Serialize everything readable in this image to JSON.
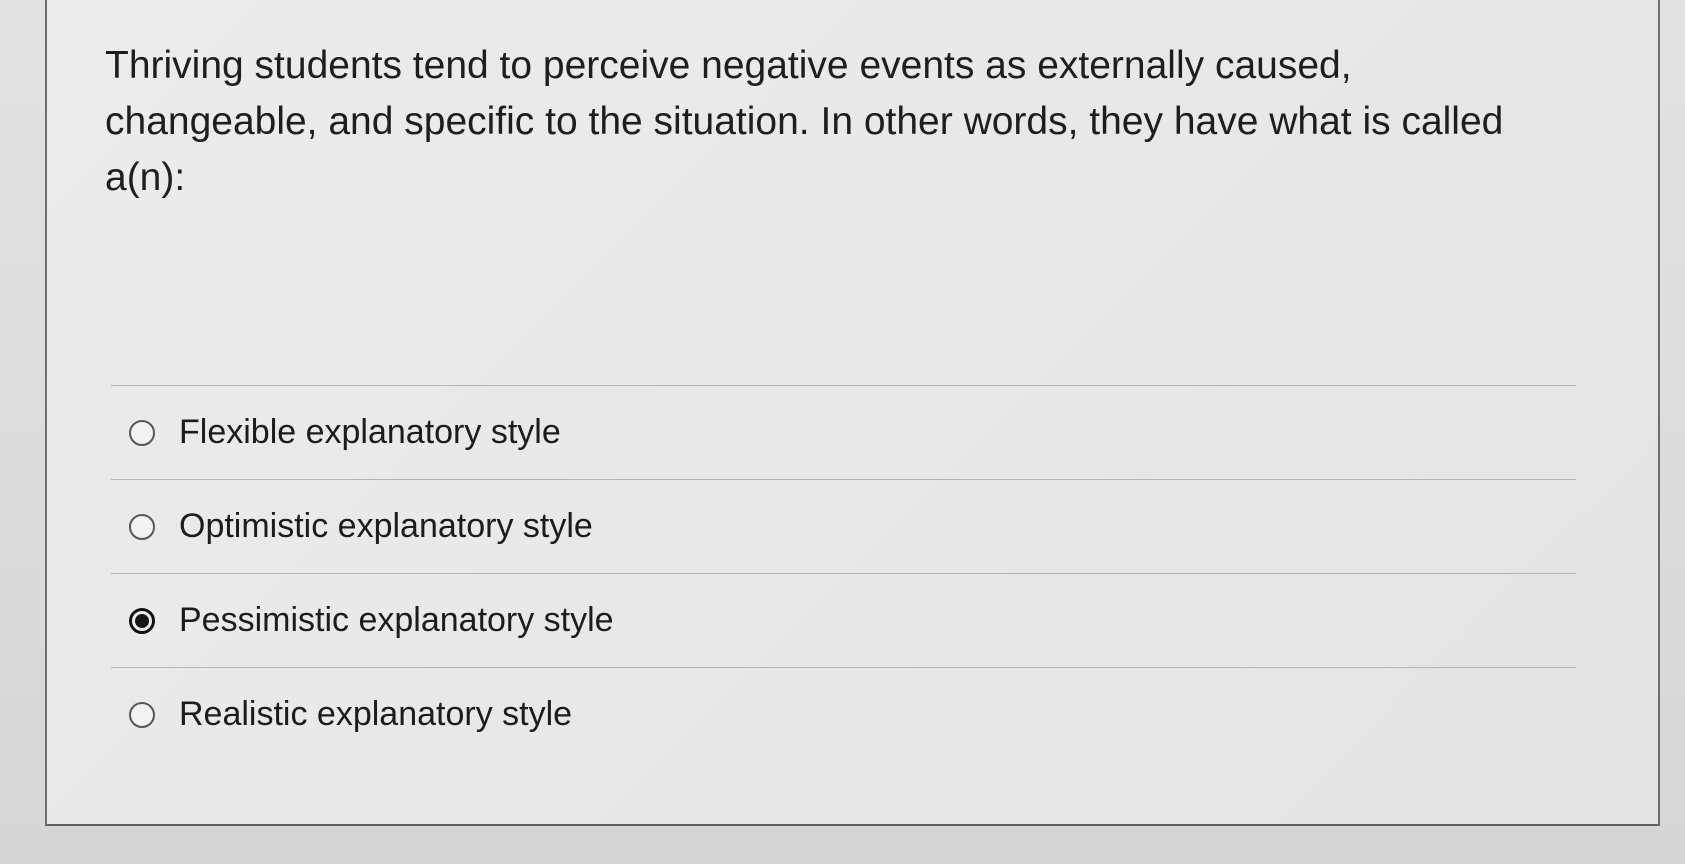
{
  "question": {
    "text": "Thriving students tend to perceive negative events as externally caused, changeable, and specific to the situation. In other words, they have what is called a(n):"
  },
  "options": [
    {
      "label": "Flexible explanatory style",
      "selected": false
    },
    {
      "label": "Optimistic explanatory style",
      "selected": false
    },
    {
      "label": "Pessimistic explanatory style",
      "selected": true
    },
    {
      "label": "Realistic explanatory style",
      "selected": false
    }
  ],
  "colors": {
    "text": "#1e1e1e",
    "card_background": "#e9e9e7",
    "divider": "#b5b5b3",
    "radio_selected": "#111111"
  }
}
